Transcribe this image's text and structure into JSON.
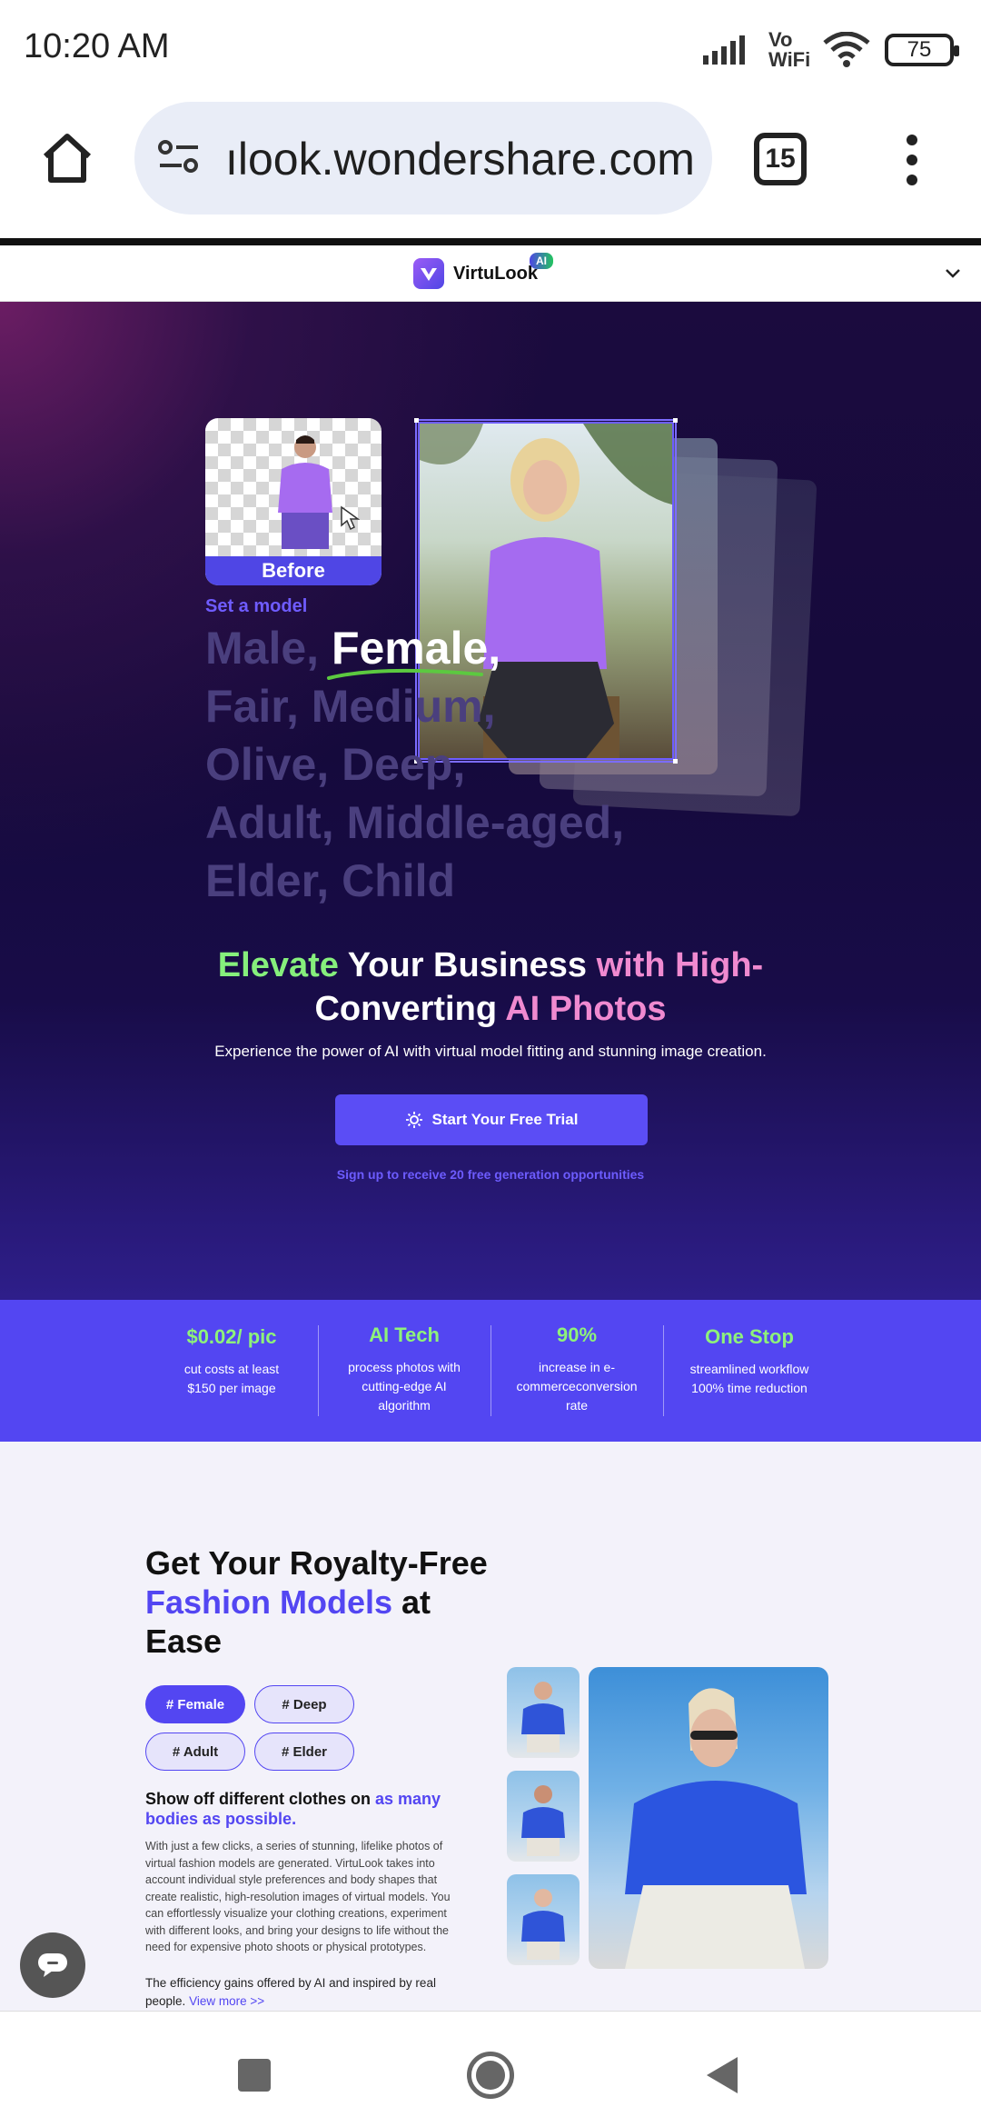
{
  "status_bar": {
    "time": "10:20 AM",
    "network": "Vo WiFi",
    "battery": "75"
  },
  "browser": {
    "url": "ılook.wondershare.com",
    "tab_count": "15"
  },
  "site_header": {
    "brand": "VirtuLook",
    "brand_badge": "AI"
  },
  "hero": {
    "before_label": "Before",
    "set_model": "Set a model",
    "model_lines": {
      "l1_a": "Male, ",
      "l1_b": "Female,",
      "l2": "Fair, Medium,",
      "l3": "Olive, Deep,",
      "l4": "Adult, Middle-aged,",
      "l5": "Elder, Child"
    },
    "title": {
      "w1": "Elevate",
      "w2": " Your Business ",
      "w3": "with High-",
      "w4": "Converting ",
      "w5": "AI Photos"
    },
    "subtitle": "Experience the power of AI with virtual model fitting and stunning image creation.",
    "cta_label": "Start Your Free Trial",
    "cta_note": "Sign up to receive 20 free generation opportunities"
  },
  "stats": [
    {
      "value": "$0.02/ pic",
      "desc": "cut costs at least $150 per image"
    },
    {
      "value": "AI Tech",
      "desc": "process photos with cutting-edge AI algorithm"
    },
    {
      "value": "90%",
      "desc": "increase in e-commerceconversion rate"
    },
    {
      "value": "One Stop",
      "desc": "streamlined workflow 100% time reduction"
    }
  ],
  "section": {
    "title_a": "Get Your Royalty-Free ",
    "title_b": "Fashion Models",
    "title_c": " at Ease",
    "tags": [
      "# Female",
      "# Deep",
      "# Adult",
      "# Elder"
    ],
    "show_off_a": "Show off different clothes on ",
    "show_off_b": "as many bodies as possible",
    "show_off_c": ".",
    "body": "With just a few clicks, a series of stunning, lifelike photos of virtual fashion models are generated. VirtuLook takes into account individual style preferences and body shapes that create realistic, high-resolution images of virtual models. You can effortlessly visualize your clothing creations, experiment with different looks, and bring your designs to life without the need for expensive photo shoots or physical prototypes.",
    "efficiency": "The efficiency gains offered by AI and inspired by real people.",
    "view_more": "View more >>"
  },
  "colors": {
    "accent": "#5346f2",
    "stat_value": "#8ef27a",
    "hero_bg": "#150a3c"
  },
  "icons": [
    "home-icon",
    "site-settings-icon",
    "tabs-icon",
    "more-menu-icon",
    "chevron-down-icon",
    "sparkle-icon",
    "chat-icon",
    "recents-icon",
    "home-nav-icon",
    "back-icon"
  ]
}
